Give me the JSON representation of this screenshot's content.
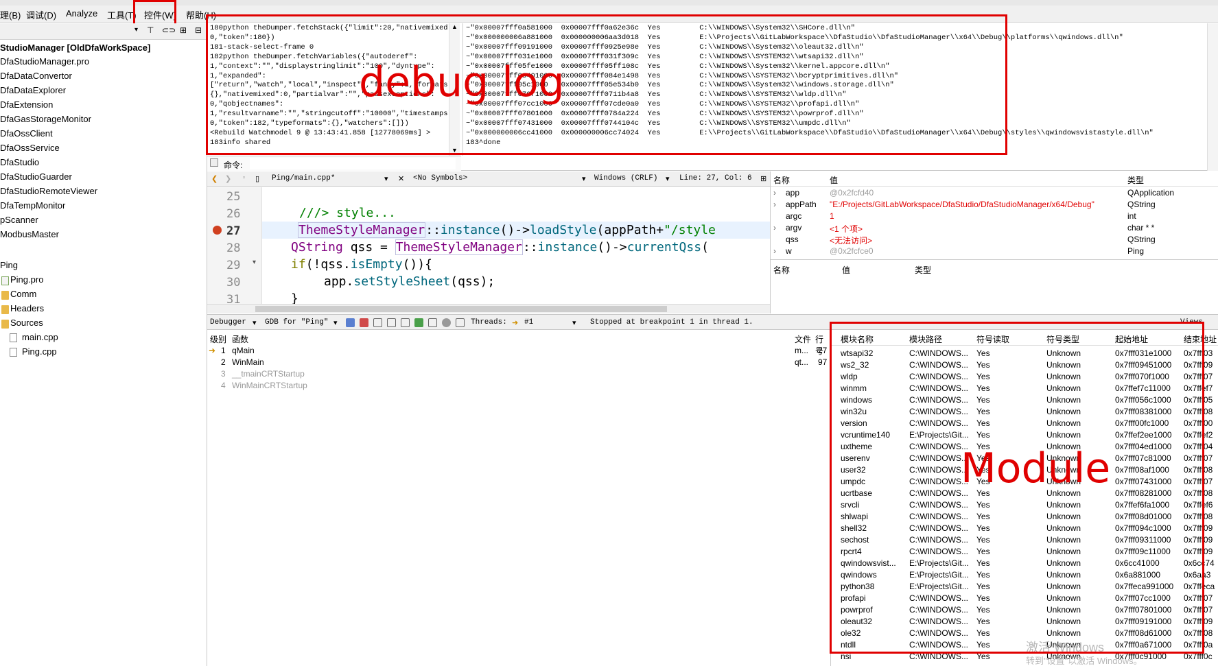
{
  "menu": {
    "items": [
      "理(B)",
      "调试(D)",
      "Analyze",
      "工具(T)",
      "控件(W)",
      "帮助(H)"
    ]
  },
  "project": {
    "root": "StudioManager [OldDfaWorkSpace]",
    "items": [
      "DfaStudioManager.pro",
      "DfaDataConvertor",
      "DfaDataExplorer",
      "DfaExtension",
      "DfaGasStorageMonitor",
      "DfaOssClient",
      "DfaOssService",
      "DfaStudio",
      "DfaStudioGuarder",
      "DfaStudioRemoteViewer",
      "DfaTempMonitor",
      "pScanner",
      "ModbusMaster",
      "Ping"
    ],
    "ping_children": [
      {
        "label": "Ping.pro",
        "icon": "pro-file-icon"
      },
      {
        "label": "Comm",
        "icon": "folder-icon"
      },
      {
        "label": "Headers",
        "icon": "folder-icon"
      },
      {
        "label": "Sources",
        "icon": "folder-icon"
      }
    ],
    "source_files": [
      "main.cpp",
      "Ping.cpp"
    ]
  },
  "debug_log": {
    "left_lines": [
      "180python theDumper.fetchStack({\"limit\":20,\"nativemixed\":",
      "0,\"token\":180})",
      "181-stack-select-frame 0",
      "182python theDumper.fetchVariables({\"autoderef\":",
      "1,\"context\":\"\",\"displaystringlimit\":\"100\",\"dyntype\":",
      "1,\"expanded\":",
      "[\"return\",\"watch\",\"local\",\"inspect\"],\"fancy\":1,\"formats\":",
      "{},\"nativemixed\":0,\"partialvar\":\"\",\"passexceptions\":",
      "0,\"qobjectnames\":",
      "1,\"resultvarname\":\"\",\"stringcutoff\":\"10000\",\"timestamps\":",
      "0,\"token\":182,\"typeformats\":{},\"watchers\":[]})",
      "<Rebuild Watchmodel 9 @ 13:43:41.858 [12778069ms] >",
      "183info shared"
    ],
    "right_lines": [
      "~\"0x00007fff0a581000  0x00007fff0a62e36c  Yes         C:\\\\WINDOWS\\\\System32\\\\SHCore.dll\\n\"",
      "~\"0x000000006a881000  0x000000006aa3d018  Yes         E:\\\\Projects\\\\GitLabWorkspace\\\\DfaStudio\\\\DfaStudioManager\\\\x64\\\\Debug\\\\platforms\\\\qwindows.dll\\n\"",
      "~\"0x00007fff09191000  0x00007fff0925e98e  Yes         C:\\\\WINDOWS\\\\System32\\\\oleaut32.dll\\n\"",
      "~\"0x00007fff031e1000  0x00007fff031f309c  Yes         C:\\\\WINDOWS\\\\SYSTEM32\\\\wtsapi32.dll\\n\"",
      "~\"0x00007fff05fe1000  0x00007fff05ff108c  Yes         C:\\\\WINDOWS\\\\System32\\\\kernel.appcore.dll\\n\"",
      "~\"0x00007fff08401000  0x00007fff084e1498  Yes         C:\\\\WINDOWS\\\\SYSTEM32\\\\bcryptprimitives.dll\\n\"",
      "~\"0x00007fff05c1000   0x00007fff05e534b0  Yes         C:\\\\WINDOWS\\\\System32\\\\windows.storage.dll\\n\"",
      "~\"0x00007fff070f1000  0x00007fff0711b4a8  Yes         C:\\\\WINDOWS\\\\SYSTEM32\\\\wldp.dll\\n\"",
      "~\"0x00007fff07cc1000  0x00007fff07cde0a0  Yes         C:\\\\WINDOWS\\\\SYSTEM32\\\\profapi.dll\\n\"",
      "~\"0x00007fff07801000  0x00007fff0784a224  Yes         C:\\\\WINDOWS\\\\SYSTEM32\\\\powrprof.dll\\n\"",
      "~\"0x00007fff07431000  0x00007fff0744104c  Yes         C:\\\\WINDOWS\\\\SYSTEM32\\\\umpdc.dll\\n\"",
      "~\"0x000000006cc41000  0x000000006cc74024  Yes         E:\\\\Projects\\\\GitLabWorkspace\\\\DfaStudio\\\\DfaStudioManager\\\\x64\\\\Debug\\\\styles\\\\qwindowsvistastyle.dll\\n\"",
      "183^done"
    ],
    "command_label": "命令:"
  },
  "editor": {
    "file": "Ping/main.cpp*",
    "symbols": "<No Symbols>",
    "line_ending": "Windows (CRLF)",
    "position": "Line: 27, Col: 6",
    "line_numbers": [
      "25",
      "26",
      "27",
      "28",
      "29",
      "30",
      "31"
    ]
  },
  "locals": {
    "headers": {
      "name": "名称",
      "value": "值",
      "type": "类型"
    },
    "rows": [
      {
        "name": "app",
        "value": "@0x2fcfd40",
        "type": "QApplication",
        "vclass": "gray",
        "expandable": true
      },
      {
        "name": "appPath",
        "value": "\"E:/Projects/GitLabWorkspace/DfaStudio/DfaStudioManager/x64/Debug\"",
        "type": "QString",
        "vclass": "red",
        "expandable": true
      },
      {
        "name": "argc",
        "value": "1",
        "type": "int",
        "vclass": "red",
        "expandable": false
      },
      {
        "name": "argv",
        "value": "<1 个项>",
        "type": "char * *",
        "vclass": "red",
        "expandable": true
      },
      {
        "name": "qss",
        "value": "<无法访问>",
        "type": "QString",
        "vclass": "red",
        "expandable": false
      },
      {
        "name": "w",
        "value": "@0x2fcfce0",
        "type": "Ping",
        "vclass": "gray",
        "expandable": true
      }
    ],
    "watch_headers": {
      "name": "名称",
      "value": "值",
      "type": "类型"
    }
  },
  "debugger_bar": {
    "mode": "Debugger",
    "engine": "GDB for \"Ping\"",
    "threads_label": "Threads:",
    "thread": "#1",
    "status": "Stopped at breakpoint 1 in thread 1.",
    "views": "Views"
  },
  "stack": {
    "headers": {
      "level": "级别",
      "function": "函数",
      "file": "文件",
      "line": "行号"
    },
    "rows": [
      {
        "level": "1",
        "function": "qMain",
        "file": "m...",
        "line": "27",
        "current": true
      },
      {
        "level": "2",
        "function": "WinMain",
        "file": "qt...",
        "line": "97",
        "current": false
      },
      {
        "level": "3",
        "function": "__tmainCRTStartup",
        "file": "",
        "line": "",
        "current": false
      },
      {
        "level": "4",
        "function": "WinMainCRTStartup",
        "file": "",
        "line": "",
        "current": false
      }
    ]
  },
  "modules": {
    "headers": [
      "模块名称",
      "模块路径",
      "符号读取",
      "符号类型",
      "起始地址",
      "结束地址"
    ],
    "rows": [
      [
        "wtsapi32",
        "C:\\WINDOWS...",
        "Yes",
        "Unknown",
        "0x7fff031e1000",
        "0x7fff03"
      ],
      [
        "ws2_32",
        "C:\\WINDOWS...",
        "Yes",
        "Unknown",
        "0x7fff09451000",
        "0x7fff09"
      ],
      [
        "wldp",
        "C:\\WINDOWS...",
        "Yes",
        "Unknown",
        "0x7fff070f1000",
        "0x7fff07"
      ],
      [
        "winmm",
        "C:\\WINDOWS...",
        "Yes",
        "Unknown",
        "0x7ffef7c11000",
        "0x7ffef7"
      ],
      [
        "windows",
        "C:\\WINDOWS...",
        "Yes",
        "Unknown",
        "0x7fff056c1000",
        "0x7fff05"
      ],
      [
        "win32u",
        "C:\\WINDOWS...",
        "Yes",
        "Unknown",
        "0x7fff08381000",
        "0x7fff08"
      ],
      [
        "version",
        "C:\\WINDOWS...",
        "Yes",
        "Unknown",
        "0x7fff00fc1000",
        "0x7fff00"
      ],
      [
        "vcruntime140",
        "E:\\Projects\\Git...",
        "Yes",
        "Unknown",
        "0x7ffef2ee1000",
        "0x7ffef2"
      ],
      [
        "uxtheme",
        "C:\\WINDOWS...",
        "Yes",
        "Unknown",
        "0x7fff04ed1000",
        "0x7fff04"
      ],
      [
        "userenv",
        "C:\\WINDOWS...",
        "Yes",
        "Unknown",
        "0x7fff07c81000",
        "0x7fff07"
      ],
      [
        "user32",
        "C:\\WINDOWS...",
        "Yes",
        "Unknown",
        "0x7fff08af1000",
        "0x7fff08"
      ],
      [
        "umpdc",
        "C:\\WINDOWS...",
        "Yes",
        "Unknown",
        "0x7fff07431000",
        "0x7fff07"
      ],
      [
        "ucrtbase",
        "C:\\WINDOWS...",
        "Yes",
        "Unknown",
        "0x7fff08281000",
        "0x7fff08"
      ],
      [
        "srvcli",
        "C:\\WINDOWS...",
        "Yes",
        "Unknown",
        "0x7ffef6fa1000",
        "0x7ffef6"
      ],
      [
        "shlwapi",
        "C:\\WINDOWS...",
        "Yes",
        "Unknown",
        "0x7fff08d01000",
        "0x7fff08"
      ],
      [
        "shell32",
        "C:\\WINDOWS...",
        "Yes",
        "Unknown",
        "0x7fff094c1000",
        "0x7fff09"
      ],
      [
        "sechost",
        "C:\\WINDOWS...",
        "Yes",
        "Unknown",
        "0x7fff09311000",
        "0x7fff09"
      ],
      [
        "rpcrt4",
        "C:\\WINDOWS...",
        "Yes",
        "Unknown",
        "0x7fff09c11000",
        "0x7fff09"
      ],
      [
        "qwindowsvist...",
        "E:\\Projects\\Git...",
        "Yes",
        "Unknown",
        "0x6cc41000",
        "0x6cc74"
      ],
      [
        "qwindows",
        "E:\\Projects\\Git...",
        "Yes",
        "Unknown",
        "0x6a881000",
        "0x6aa3"
      ],
      [
        "python38",
        "E:\\Projects\\Git...",
        "Yes",
        "Unknown",
        "0x7ffeca991000",
        "0x7ffeca"
      ],
      [
        "profapi",
        "C:\\WINDOWS...",
        "Yes",
        "Unknown",
        "0x7fff07cc1000",
        "0x7fff07"
      ],
      [
        "powrprof",
        "C:\\WINDOWS...",
        "Yes",
        "Unknown",
        "0x7fff07801000",
        "0x7fff07"
      ],
      [
        "oleaut32",
        "C:\\WINDOWS...",
        "Yes",
        "Unknown",
        "0x7fff09191000",
        "0x7fff09"
      ],
      [
        "ole32",
        "C:\\WINDOWS...",
        "Yes",
        "Unknown",
        "0x7fff08d61000",
        "0x7fff08"
      ],
      [
        "ntdll",
        "C:\\WINDOWS...",
        "Yes",
        "Unknown",
        "0x7fff0a671000",
        "0x7fff0a"
      ],
      [
        "nsi",
        "C:\\WINDOWS...",
        "Yes",
        "Unknown",
        "0x7fff0c91000",
        "0x7fff0c"
      ]
    ]
  },
  "annotations": {
    "debug_log_label": "debug log",
    "module_label": "Module",
    "color": "#e00000"
  },
  "watermark": {
    "line1": "激活 Windows",
    "line2": "转到\"设置\"以激活 Windows。"
  }
}
